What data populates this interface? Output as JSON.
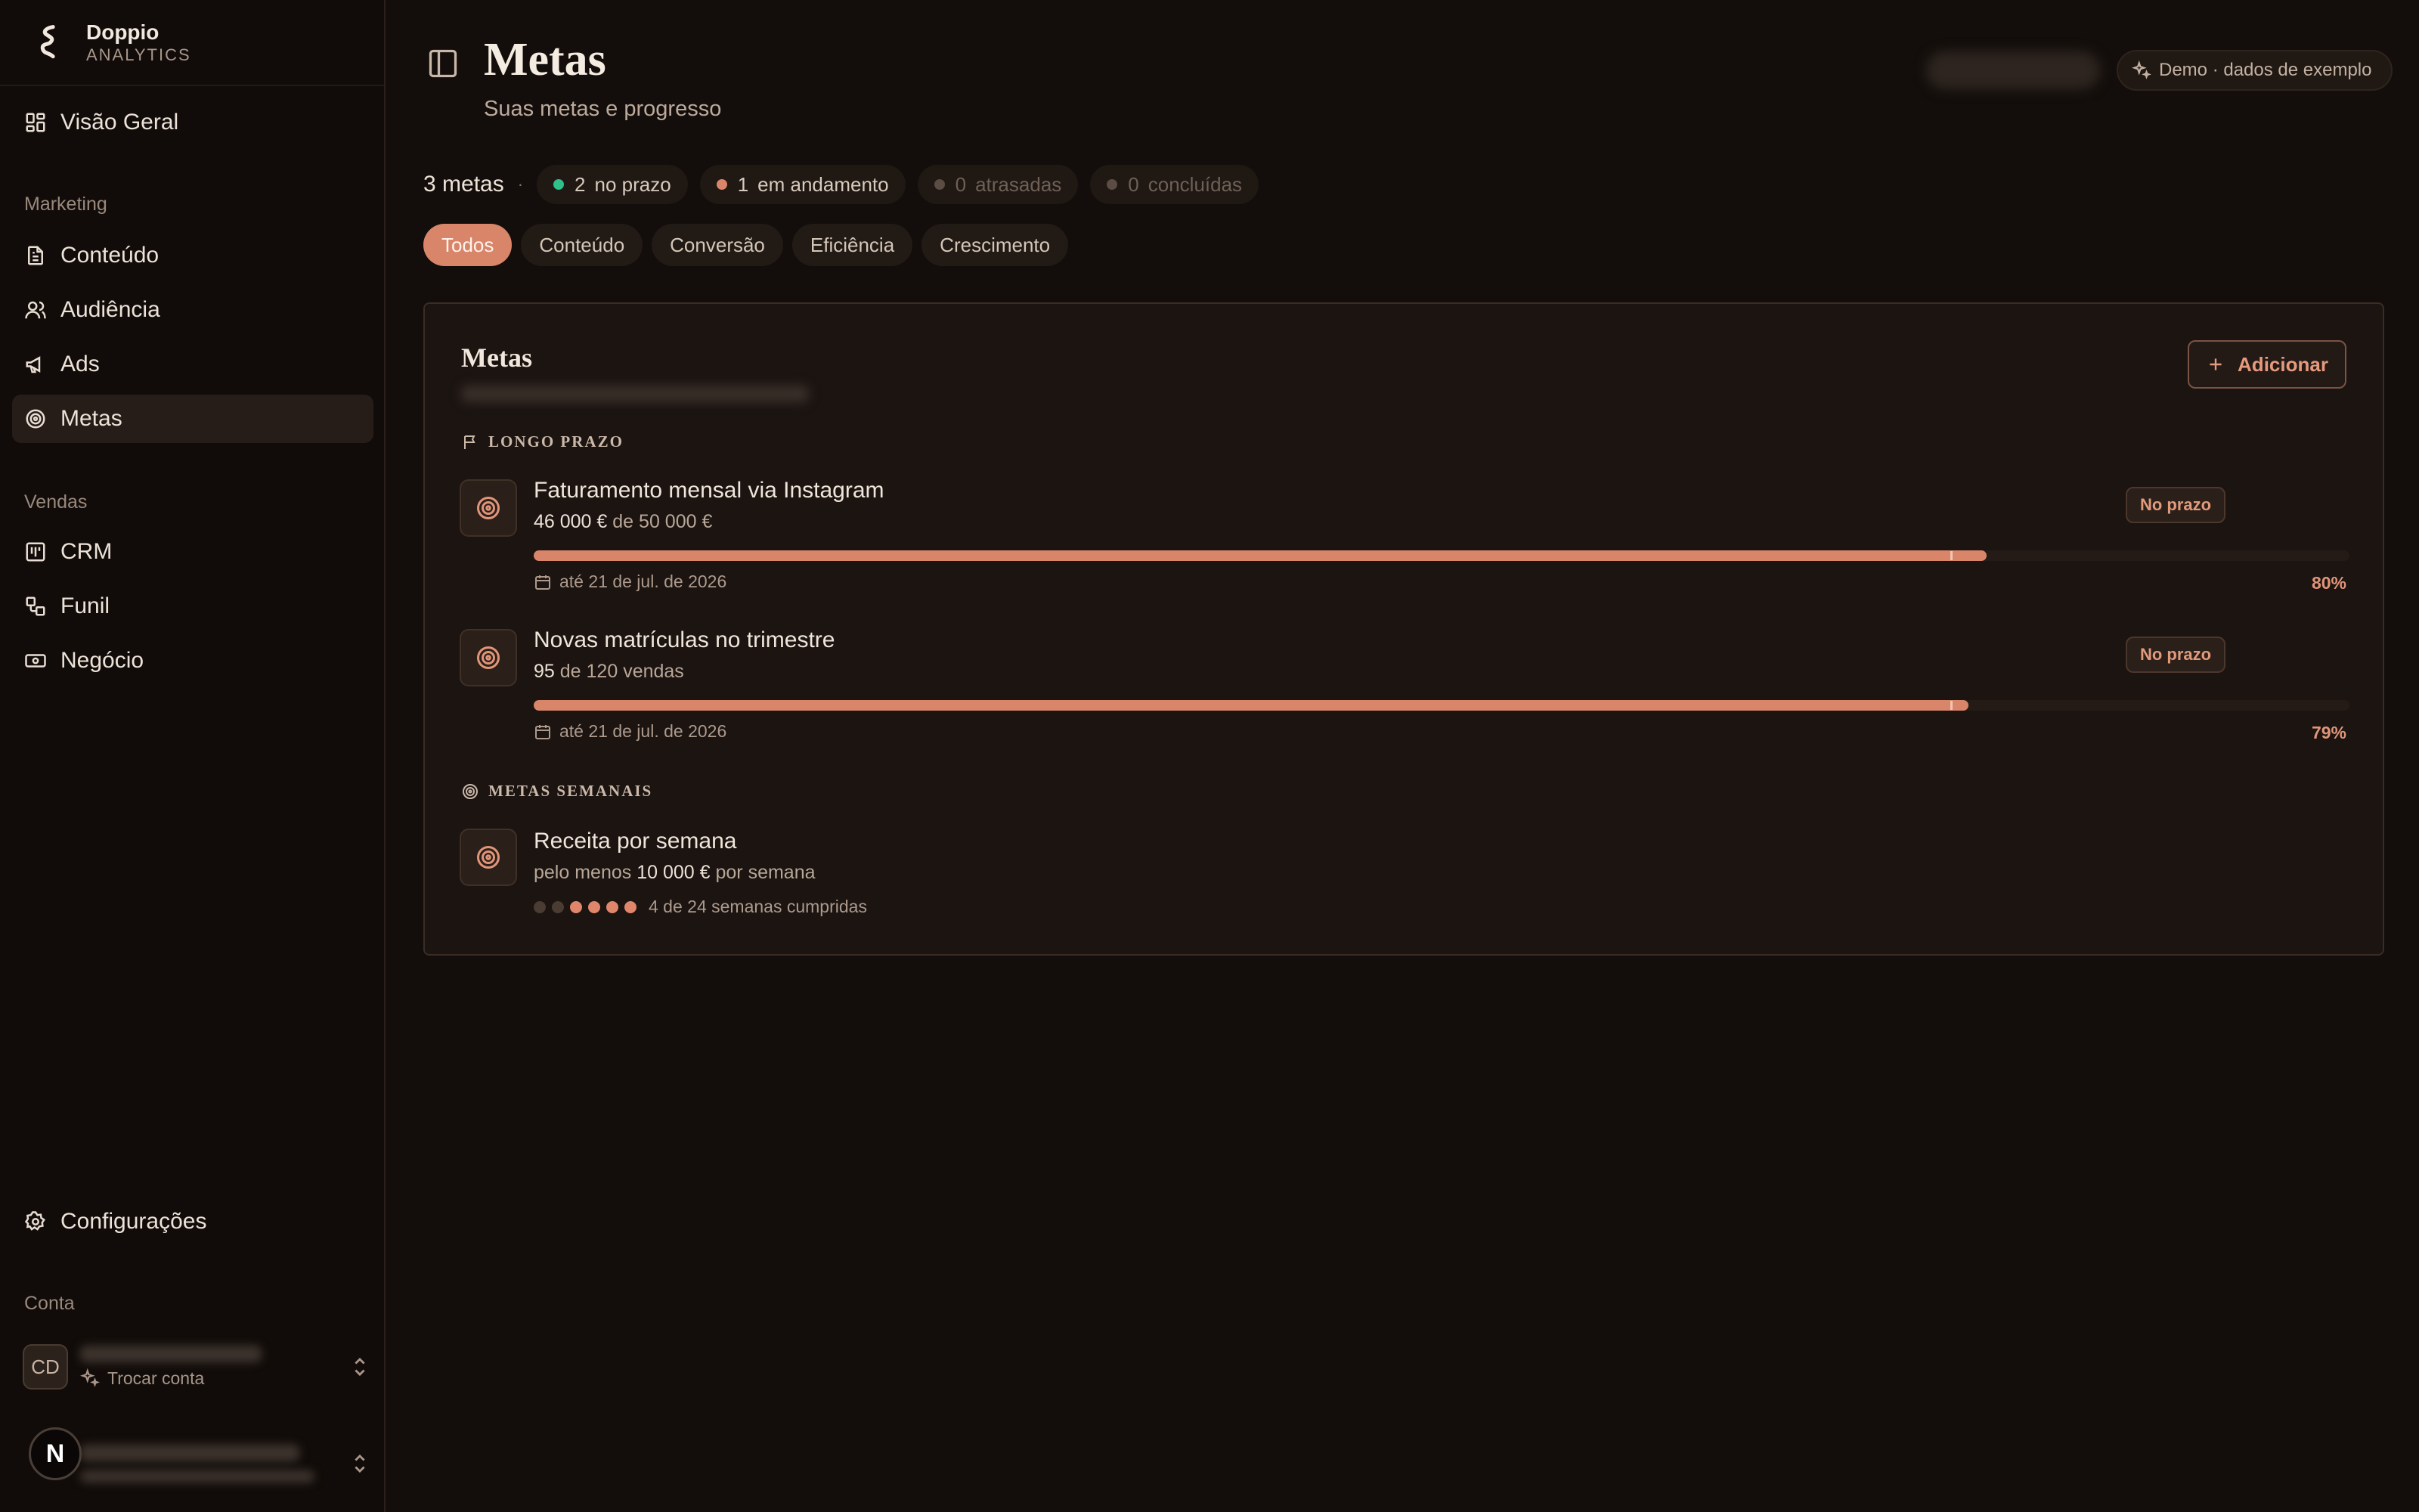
{
  "brand": {
    "name": "Doppio",
    "subtitle": "ANALYTICS"
  },
  "sidebar": {
    "overview": "Visão Geral",
    "marketing_label": "Marketing",
    "marketing": [
      "Conteúdo",
      "Audiência",
      "Ads",
      "Metas"
    ],
    "sales_label": "Vendas",
    "sales": [
      "CRM",
      "Funil",
      "Negócio"
    ],
    "settings": "Configurações",
    "account_label": "Conta",
    "account_initials": "CD",
    "switch_account": "Trocar conta",
    "badge_letter": "N",
    "active_item": "Metas"
  },
  "header": {
    "title": "Metas",
    "subtitle": "Suas metas e progresso",
    "demo_label": "Demo · dados de exemplo"
  },
  "stats": {
    "total": "3 metas",
    "separator": "·",
    "chips": [
      {
        "count": "2",
        "label": "no prazo",
        "color": "#2fbf8a"
      },
      {
        "count": "1",
        "label": "em andamento",
        "color": "#d8856a"
      },
      {
        "count": "0",
        "label": "atrasadas",
        "color": "#6a5a50"
      },
      {
        "count": "0",
        "label": "concluídas",
        "color": "#6a5a50"
      }
    ]
  },
  "filters": [
    "Todos",
    "Conteúdo",
    "Conversão",
    "Eficiência",
    "Crescimento"
  ],
  "card": {
    "title": "Metas",
    "add_label": "Adicionar",
    "long_term_label": "LONGO PRAZO",
    "weekly_label": "METAS SEMANAIS",
    "goals": [
      {
        "title": "Faturamento mensal via Instagram",
        "current": "46 000 €",
        "of": "de",
        "target": "50 000 €",
        "status": "No prazo",
        "progress": 0.8,
        "marker": 0.78,
        "date": "até 21 de jul. de 2026",
        "percent": "80%"
      },
      {
        "title": "Novas matrículas no trimestre",
        "current": "95",
        "of": "de",
        "target": "120 vendas",
        "status": "No prazo",
        "progress": 0.79,
        "marker": 0.78,
        "date": "até 21 de jul. de 2026",
        "percent": "79%"
      }
    ],
    "weekly": {
      "title": "Receita por semana",
      "prefix": "pelo menos",
      "amount": "10 000 €",
      "suffix": "por semana",
      "weeks_done": "4 de 24 semanas cumpridas",
      "dots": [
        false,
        false,
        true,
        true,
        true,
        true
      ]
    }
  },
  "colors": {
    "accent": "#d8856a",
    "accent_text": "#e19a7c",
    "on_track": "#2fbf8a"
  }
}
